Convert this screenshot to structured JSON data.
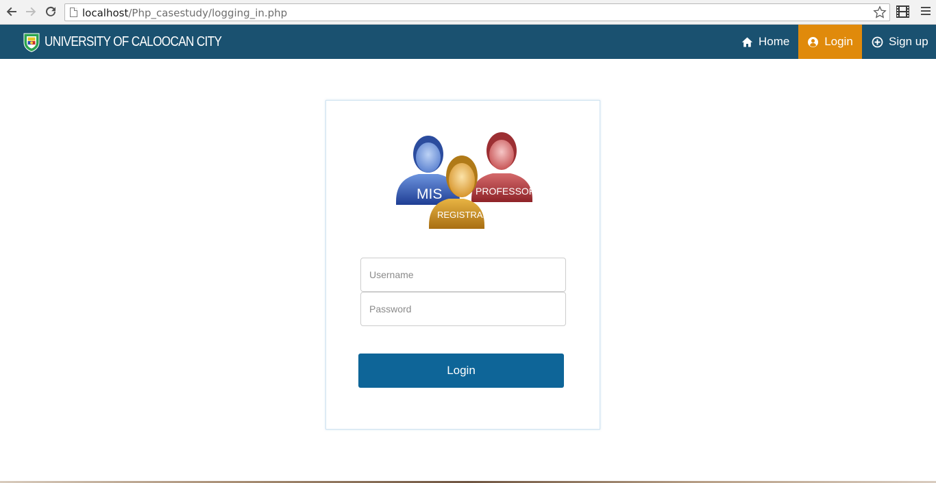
{
  "browser": {
    "url_host": "localhost",
    "url_path": "/Php_casestudy/logging_in.php"
  },
  "navbar": {
    "brand": "UNIVERSITY OF CALOOCAN CITY",
    "items": [
      {
        "label": "Home",
        "icon": "home-icon"
      },
      {
        "label": "Login",
        "icon": "user-circle-icon",
        "active": true
      },
      {
        "label": "Sign up",
        "icon": "plus-circle-icon"
      }
    ],
    "colors": {
      "bar": "#1a5170",
      "active": "#e08a0b"
    }
  },
  "login_card": {
    "roles": [
      "MIS",
      "PROFESSOR",
      "REGISTRAR"
    ],
    "username_placeholder": "Username",
    "password_placeholder": "Password",
    "submit_label": "Login",
    "button_color": "#0e6598"
  }
}
